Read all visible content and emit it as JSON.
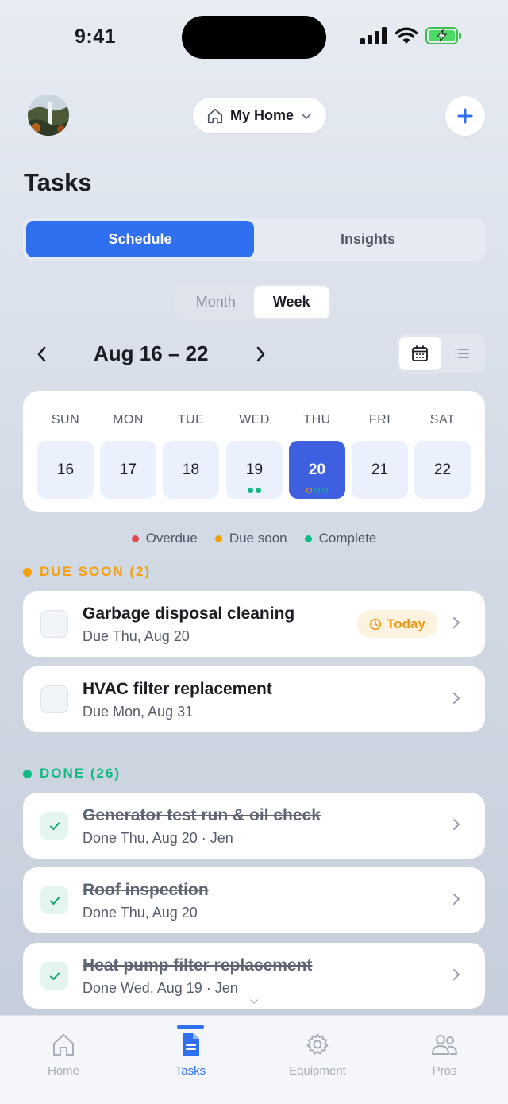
{
  "status_bar": {
    "time": "9:41"
  },
  "header": {
    "home_label": "My Home"
  },
  "page_title": "Tasks",
  "main_tabs": [
    {
      "label": "Schedule",
      "active": true
    },
    {
      "label": "Insights",
      "active": false
    }
  ],
  "range_tabs": [
    {
      "label": "Month",
      "active": false
    },
    {
      "label": "Week",
      "active": true
    }
  ],
  "range_label": "Aug 16 – 22",
  "week": [
    {
      "day": "SUN",
      "date": "16",
      "dots": []
    },
    {
      "day": "MON",
      "date": "17",
      "dots": []
    },
    {
      "day": "TUE",
      "date": "18",
      "dots": []
    },
    {
      "day": "WED",
      "date": "19",
      "dots": [
        "complete",
        "complete"
      ]
    },
    {
      "day": "THU",
      "date": "20",
      "dots": [
        "due",
        "complete",
        "complete"
      ],
      "selected": true
    },
    {
      "day": "FRI",
      "date": "21",
      "dots": []
    },
    {
      "day": "SAT",
      "date": "22",
      "dots": []
    }
  ],
  "legend": [
    {
      "label": "Overdue",
      "color": "#e5484d"
    },
    {
      "label": "Due soon",
      "color": "#f59e0b"
    },
    {
      "label": "Complete",
      "color": "#10b981"
    }
  ],
  "due_soon_section": {
    "title": "DUE SOON (2)",
    "color": "#f59e0b",
    "tasks": [
      {
        "title": "Garbage disposal cleaning",
        "sub": "Due Thu, Aug 20",
        "badge": "Today"
      },
      {
        "title": "HVAC filter replacement",
        "sub": "Due Mon, Aug 31"
      }
    ]
  },
  "done_section": {
    "title": "DONE (26)",
    "color": "#10b981",
    "tasks": [
      {
        "title": "Generator test run & oil check",
        "sub": "Done Thu, Aug 20 · Jen"
      },
      {
        "title": "Roof inspection",
        "sub": "Done Thu, Aug 20"
      },
      {
        "title": "Heat pump filter replacement",
        "sub": "Done Wed, Aug 19 · Jen"
      }
    ]
  },
  "tabbar": [
    {
      "label": "Home",
      "icon": "home-icon"
    },
    {
      "label": "Tasks",
      "icon": "document-icon",
      "active": true
    },
    {
      "label": "Equipment",
      "icon": "gear-icon"
    },
    {
      "label": "Pros",
      "icon": "people-icon"
    }
  ],
  "colors": {
    "accent": "#2f6ff0",
    "selected_day": "#3e5fe0"
  }
}
